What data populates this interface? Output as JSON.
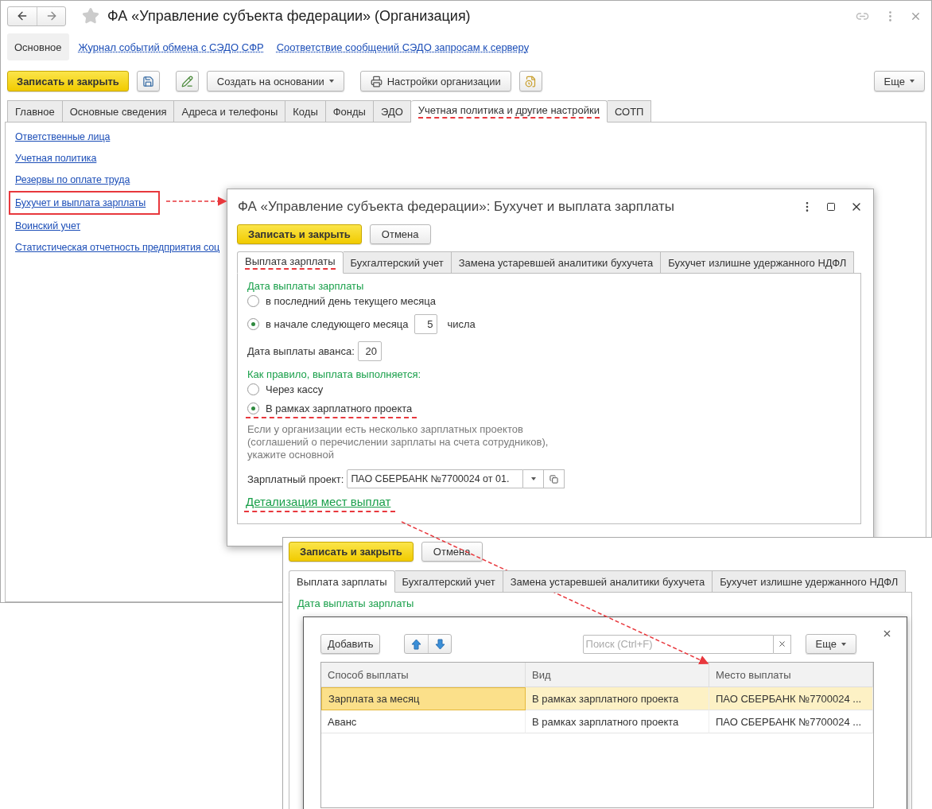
{
  "main": {
    "title": "ФА «Управление субъекта федерации» (Организация)",
    "sections": [
      {
        "label": "Основное",
        "selected": true
      },
      {
        "label": "Журнал событий обмена с СЭДО СФР",
        "selected": false
      },
      {
        "label": "Соответствие сообщений СЭДО запросам к серверу",
        "selected": false
      }
    ],
    "toolbar": {
      "save_close": "Записать и закрыть",
      "create_based": "Создать на основании",
      "org_settings": "Настройки организации",
      "more": "Еще"
    },
    "tabs": [
      {
        "label": "Главное",
        "selected": false,
        "annotated": false
      },
      {
        "label": "Основные сведения",
        "selected": false,
        "annotated": false
      },
      {
        "label": "Адреса и телефоны",
        "selected": false,
        "annotated": false
      },
      {
        "label": "Коды",
        "selected": false,
        "annotated": false
      },
      {
        "label": "Фонды",
        "selected": false,
        "annotated": false
      },
      {
        "label": "ЭДО",
        "selected": false,
        "annotated": false
      },
      {
        "label": "Учетная политика и другие настройки",
        "selected": true,
        "annotated": true
      },
      {
        "label": "СОТП",
        "selected": false,
        "annotated": false
      }
    ],
    "links": [
      {
        "label": "Ответственные лица",
        "highlighted": false
      },
      {
        "label": "Учетная политика",
        "highlighted": false
      },
      {
        "label": "Резервы по оплате труда",
        "highlighted": false
      },
      {
        "label": "Бухучет и выплата зарплаты",
        "highlighted": true
      },
      {
        "label": "Воинский учет",
        "highlighted": false
      },
      {
        "label": "Статистическая отчетность предприятия соц",
        "highlighted": false
      }
    ]
  },
  "dialog": {
    "title": "ФА «Управление субъекта федерации»: Бухучет и выплата зарплаты",
    "save_close": "Записать и закрыть",
    "cancel": "Отмена",
    "tabs": [
      {
        "label": "Выплата зарплаты",
        "selected": true,
        "annotated": true
      },
      {
        "label": "Бухгалтерский учет",
        "selected": false,
        "annotated": false
      },
      {
        "label": "Замена устаревшей аналитики бухучета",
        "selected": false,
        "annotated": false
      },
      {
        "label": "Бухучет излишне удержанного НДФЛ",
        "selected": false,
        "annotated": false
      }
    ],
    "pay_date": {
      "label": "Дата выплаты зарплаты",
      "options": [
        {
          "label": "в последний день текущего месяца",
          "selected": false,
          "annotated": false
        },
        {
          "label": "в начале следующего месяца",
          "selected": true,
          "annotated": false,
          "day": "5",
          "day_suffix": "числа"
        }
      ]
    },
    "advance": {
      "label": "Дата выплаты аванса:",
      "value": "20"
    },
    "method": {
      "label": "Как правило, выплата выполняется:",
      "options": [
        {
          "label": "Через кассу",
          "selected": false,
          "annotated": false
        },
        {
          "label": "В рамках зарплатного проекта",
          "selected": true,
          "annotated": true
        }
      ]
    },
    "hint": "Если у организации есть несколько зарплатных проектов\n(соглашений о перечислении зарплаты на счета сотрудников),\nукажите основной",
    "project": {
      "label": "Зарплатный проект:",
      "value": "ПАО СБЕРБАНК №7700024 от 01."
    },
    "detail_link": {
      "label": "Детализация мест выплат",
      "annotated": true
    }
  },
  "list_window": {
    "save_close": "Записать и закрыть",
    "cancel": "Отмена",
    "tabs": [
      {
        "label": "Выплата зарплаты",
        "selected": true
      },
      {
        "label": "Бухгалтерский учет",
        "selected": false
      },
      {
        "label": "Замена устаревшей аналитики бухучета",
        "selected": false
      },
      {
        "label": "Бухучет излишне удержанного НДФЛ",
        "selected": false
      }
    ],
    "section_label": "Дата выплаты зарплаты",
    "list": {
      "add": "Добавить",
      "search_placeholder": "Поиск (Ctrl+F)",
      "more": "Еще",
      "columns": [
        "Способ выплаты",
        "Вид",
        "Место выплаты"
      ],
      "rows": [
        {
          "cells": [
            "Зарплата за месяц",
            "В рамках зарплатного проекта",
            "ПАО СБЕРБАНК №7700024 ..."
          ],
          "selected": true
        },
        {
          "cells": [
            "Аванс",
            "В рамках зарплатного проекта",
            "ПАО СБЕРБАНК №7700024 ..."
          ],
          "selected": false
        }
      ]
    }
  }
}
